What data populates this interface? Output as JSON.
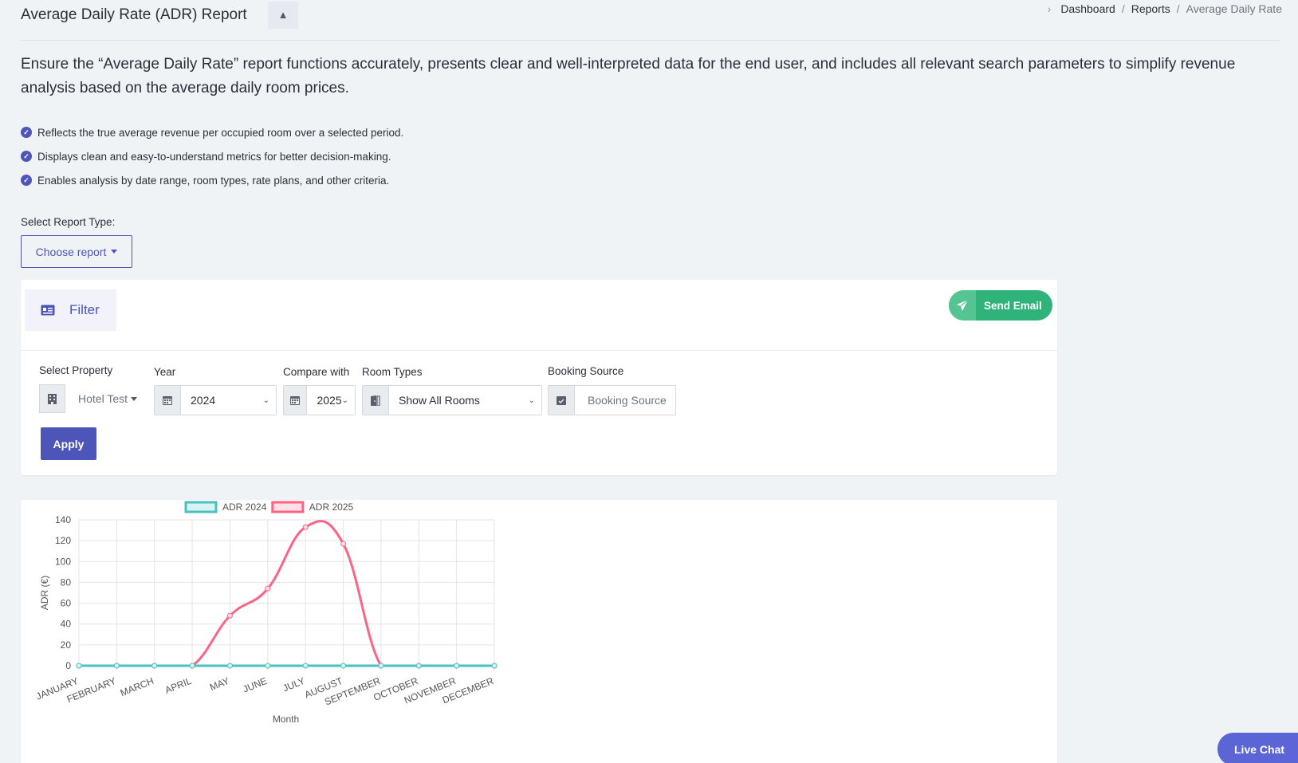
{
  "header": {
    "title": "Average Daily Rate (ADR) Report",
    "collapse_symbol": "▲",
    "breadcrumb": [
      "Dashboard",
      "Reports"
    ],
    "breadcrumb_current": "Average Daily Rate",
    "breadcrumb_sep": "/"
  },
  "intro": {
    "lead": "Ensure the “Average Daily Rate” report functions accurately, presents clear and well-interpreted data for the end user, and includes all relevant search parameters to simplify revenue analysis based on the average daily room prices.",
    "bullets": [
      "Reflects the true average revenue per occupied room over a selected period.",
      "Displays clean and easy-to-understand metrics for better decision-making.",
      "Enables analysis by date range, room types, rate plans, and other criteria."
    ]
  },
  "report_type": {
    "label": "Select Report Type:",
    "button": "Choose report"
  },
  "filter": {
    "tab_label": "Filter",
    "send_email": "Send Email",
    "property_label": "Select Property",
    "property_value": "Hotel Test",
    "year_label": "Year",
    "year_value": "2024",
    "compare_label": "Compare with",
    "compare_value": "2025",
    "room_types_label": "Room Types",
    "room_types_value": "Show All Rooms",
    "booking_source_label": "Booking Source",
    "booking_source_placeholder": "Booking Source",
    "apply": "Apply"
  },
  "chart_data": {
    "type": "line",
    "categories": [
      "JANUARY",
      "FEBRUARY",
      "MARCH",
      "APRIL",
      "MAY",
      "JUNE",
      "JULY",
      "AUGUST",
      "SEPTEMBER",
      "OCTOBER",
      "NOVEMBER",
      "DECEMBER"
    ],
    "series": [
      {
        "name": "ADR 2024",
        "color": "#4bc0c0",
        "fill": "#d9f2f2",
        "values": [
          0,
          0,
          0,
          0,
          0,
          0,
          0,
          0,
          0,
          0,
          0,
          0
        ]
      },
      {
        "name": "ADR 2025",
        "color": "#ff6384",
        "fill": "#ffe0e6",
        "values": [
          0,
          0,
          0,
          0,
          48,
          74,
          133,
          117,
          0,
          0,
          0,
          0
        ]
      }
    ],
    "title": "",
    "xlabel": "Month",
    "ylabel": "ADR (€)",
    "ylim": [
      0,
      140
    ],
    "yticks": [
      0,
      20,
      40,
      60,
      80,
      100,
      120,
      140
    ],
    "grid": true,
    "legend": "top"
  },
  "live_chat": "Live Chat"
}
